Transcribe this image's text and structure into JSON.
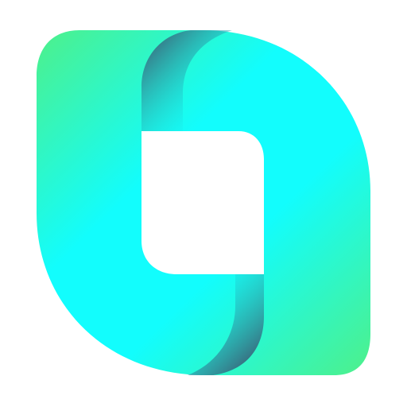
{
  "logo": {
    "icon": "leaf-square-logo-icon",
    "colors": {
      "green": "#4EF08A",
      "cyan": "#12FDFD",
      "shadow": "#3A5F76",
      "background": "#FFFFFF"
    }
  }
}
